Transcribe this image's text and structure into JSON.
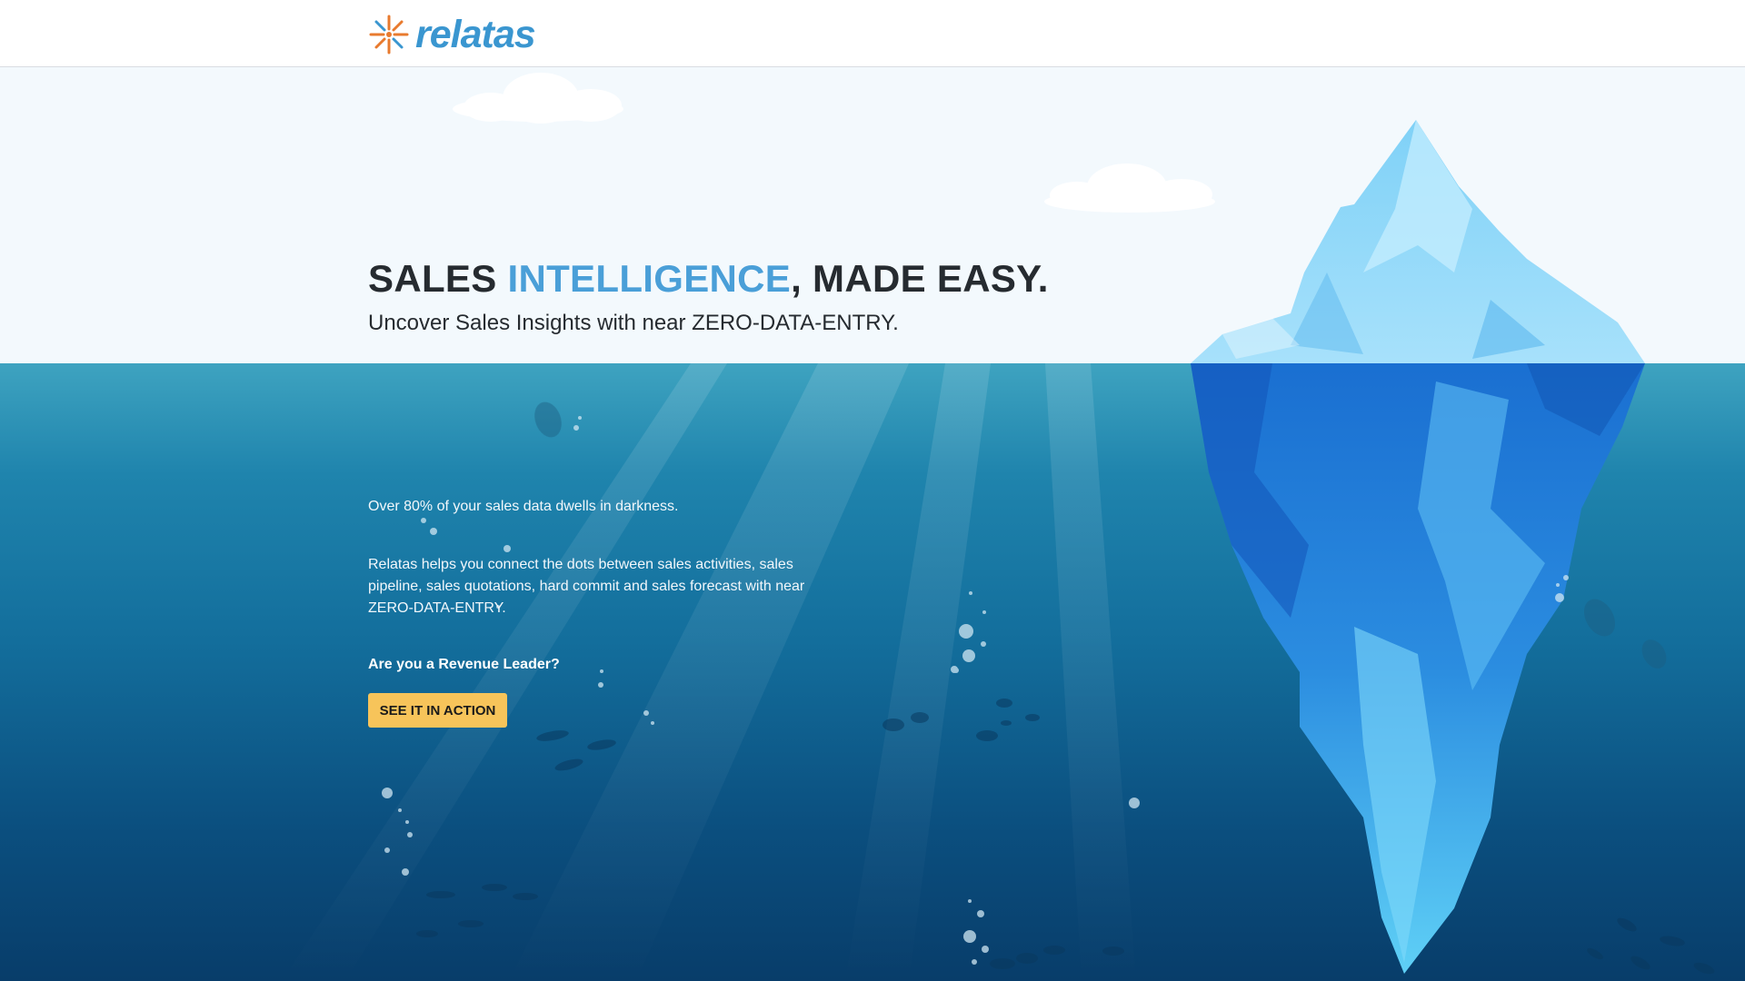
{
  "brand": {
    "name": "relatas",
    "icon": "sunburst-logo-icon",
    "logo_color": "#3a96d0",
    "mark_colors": [
      "#e87a2e",
      "#3a96d0"
    ]
  },
  "hero": {
    "headline_part1": "SALES ",
    "headline_accent": "INTELLIGENCE",
    "headline_part2": ", MADE EASY.",
    "subheadline": "Uncover Sales Insights with near ZERO-DATA-ENTRY."
  },
  "content": {
    "paragraph1": "Over 80% of your sales data dwells in darkness.",
    "paragraph2": "Relatas helps you connect the dots between sales activities, sales pipeline, sales quotations, hard commit and sales forecast with near ZERO-DATA-ENTRY.",
    "question": "Are you a Revenue Leader?",
    "cta_label": "SEE IT IN ACTION"
  },
  "colors": {
    "accent_blue": "#4a9fd8",
    "cta_yellow": "#f7c45a",
    "headline_dark": "#262b30",
    "sea_top": "#3ea3c0",
    "sea_bottom": "#083d6a",
    "sky": "#f3f9fd"
  },
  "illustration": {
    "icons": [
      "cloud-icon",
      "iceberg-icon",
      "fish-icon",
      "bubble-icon",
      "diver-icon"
    ]
  }
}
